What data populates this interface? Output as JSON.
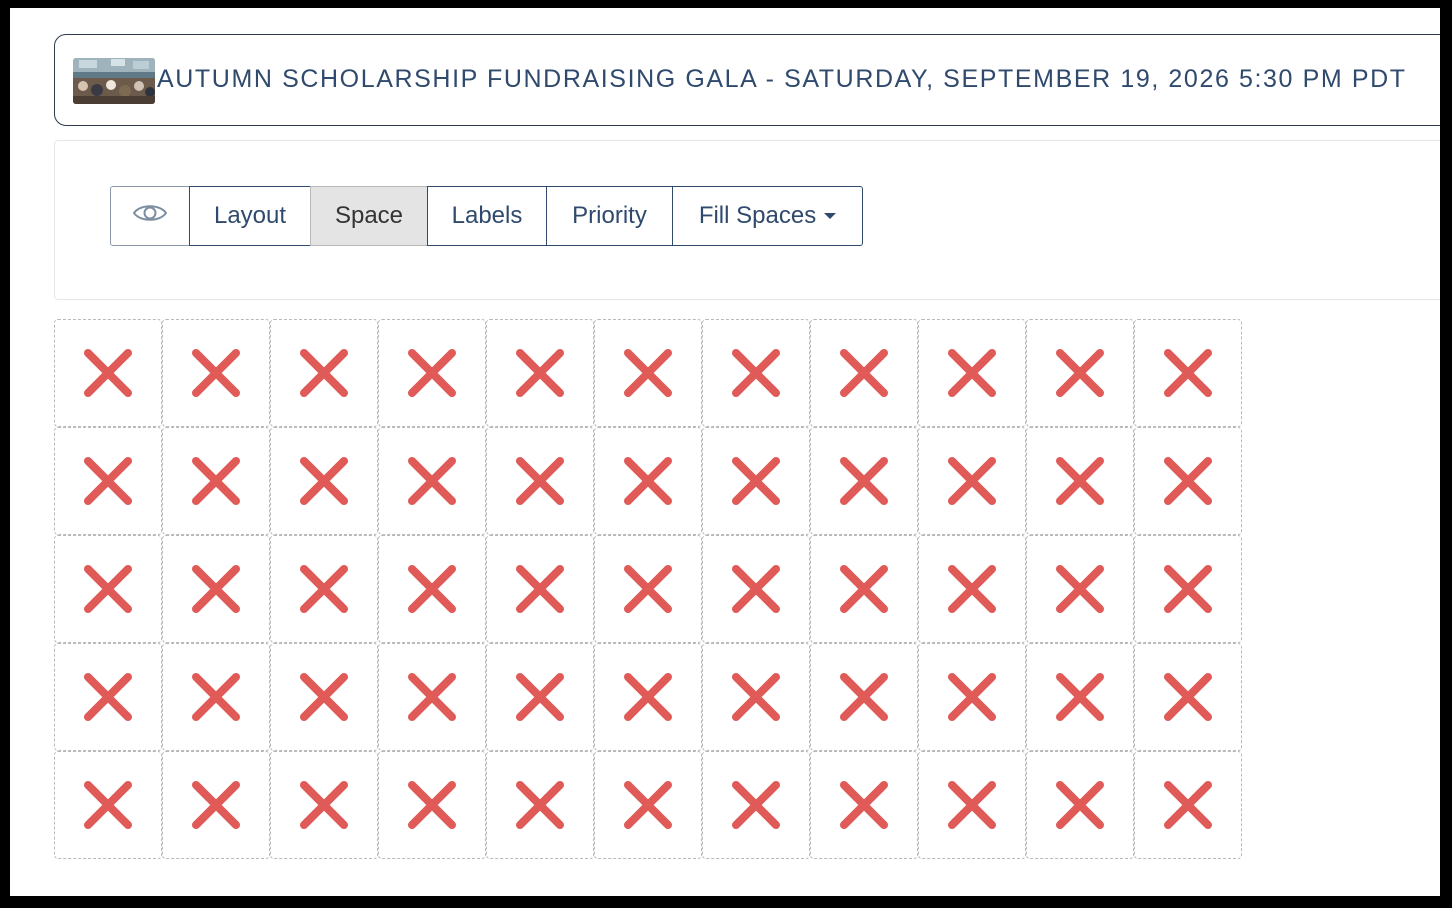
{
  "event": {
    "title": "AUTUMN SCHOLARSHIP FUNDRAISING GALA - SATURDAY, SEPTEMBER 19, 2026 5:30 PM PDT",
    "thumbnail_icon": "event-photo-thumbnail"
  },
  "toolbar": {
    "view_icon": "eye-icon",
    "buttons": [
      {
        "label": "Layout",
        "active": false
      },
      {
        "label": "Space",
        "active": true
      },
      {
        "label": "Labels",
        "active": false
      },
      {
        "label": "Priority",
        "active": false
      },
      {
        "label": "Fill Spaces",
        "active": false,
        "dropdown": true
      }
    ]
  },
  "seat_grid": {
    "rows": 5,
    "columns": 11,
    "cell_state": "unavailable",
    "cell_icon": "x-mark-icon",
    "mark_color": "#e05a57"
  },
  "colors": {
    "accent": "#2f4a6d",
    "active_button_bg": "#e4e4e4",
    "cell_border": "#b9b9b9"
  }
}
